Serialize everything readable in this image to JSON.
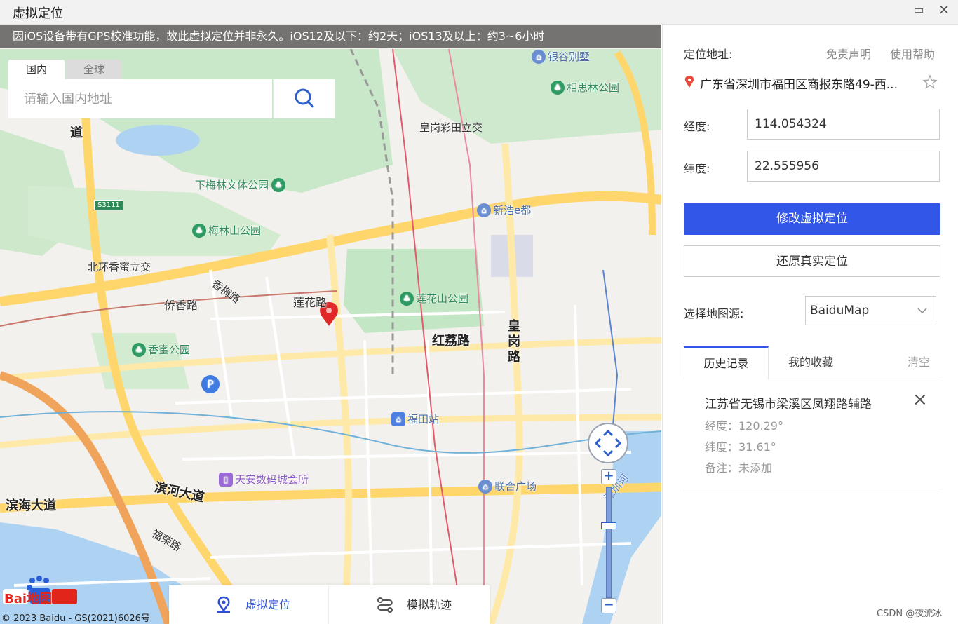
{
  "window": {
    "title": "虚拟定位",
    "maximize": "▭",
    "close": "×"
  },
  "map": {
    "notice": "因iOS设备带有GPS校准功能，故此虚拟定位并非永久。iOS12及以下：约2天；iOS13及以上：约3~6小时",
    "search": {
      "tab_domestic": "国内",
      "tab_global": "全球",
      "placeholder": "请输入国内地址"
    },
    "labels": {
      "yingu": "银谷别墅",
      "xiangsilin": "相思林公园",
      "huanggang": "皇岗彩田立交",
      "xiameilin": "下梅林文体公园",
      "xinhao": "新浩e都",
      "meilinshan": "梅林山公园",
      "beihuan": "北环香蜜立交",
      "xiangmeilu": "香梅路",
      "qiaoxianglu": "侨香路",
      "lianhualu": "莲花路",
      "lianhuashan": "莲花山公园",
      "honglilu": "红荔路",
      "huanggangroad": "皇\n岗\n路",
      "xiangmi": "香蜜公园",
      "futian": "福田站",
      "tianan": "天安数码城会所",
      "lianhe": "联合广场",
      "binhe": "滨河大道",
      "binhai": "滨海大道",
      "furong": "福荣路",
      "dao": "道",
      "s3111": "S3111",
      "river": "深圳河"
    },
    "bottom_tabs": {
      "virtual": "虚拟定位",
      "track": "模拟轨迹"
    },
    "copyright": "© 2023 Baidu - GS(2021)6026号",
    "logo_text": "Bai地图",
    "zoom_in": "+",
    "zoom_out": "−"
  },
  "panel": {
    "address_label": "定位地址:",
    "disclaimer": "免责声明",
    "help": "使用帮助",
    "address": "广东省深圳市福田区商报东路49-西...",
    "lng_label": "经度:",
    "lng_value": "114.054324",
    "lat_label": "纬度:",
    "lat_value": "22.555956",
    "modify_button": "修改虚拟定位",
    "restore_button": "还原真实定位",
    "source_label": "选择地图源:",
    "source_value": "BaiduMap",
    "tabs": {
      "history": "历史记录",
      "favorites": "我的收藏",
      "clear": "清空"
    },
    "history": [
      {
        "address": "江苏省无锡市梁溪区凤翔路辅路",
        "lng": "经度：120.29°",
        "lat": "纬度：31.61°",
        "note": "备注：未添加"
      }
    ]
  },
  "watermark": "CSDN @夜流冰",
  "colors": {
    "accent": "#3256e8",
    "park": "#c7ecc9",
    "road": "#ffd66b"
  }
}
